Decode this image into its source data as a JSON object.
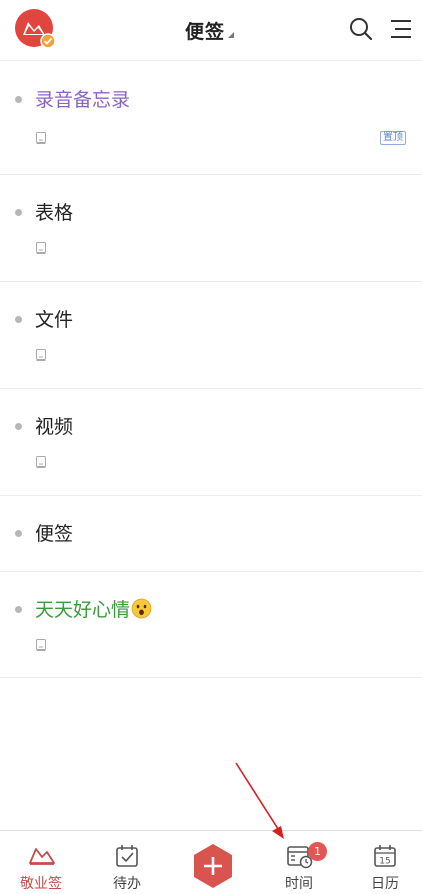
{
  "header": {
    "title": "便签"
  },
  "notes": [
    {
      "title": "录音备忘录",
      "color": "#8a63c6",
      "pinned_label": "置顶"
    },
    {
      "title": "表格",
      "color": "#222222"
    },
    {
      "title": "文件",
      "color": "#222222"
    },
    {
      "title": "视频",
      "color": "#222222"
    },
    {
      "title": "便签",
      "color": "#222222"
    },
    {
      "title": "天天好心情",
      "color": "#3b9b3b"
    }
  ],
  "tabbar": {
    "items": [
      {
        "label": "敬业签",
        "icon": "boat-icon",
        "active": true
      },
      {
        "label": "待办",
        "icon": "todo-check-icon"
      },
      {
        "label": "",
        "icon": "add-icon"
      },
      {
        "label": "时间",
        "icon": "time-calendar-icon",
        "badge": "1"
      },
      {
        "label": "日历",
        "icon": "calendar-15-icon",
        "day": "15"
      }
    ]
  },
  "colors": {
    "accent": "#d9534f",
    "active_tab": "#c84a4a",
    "dot": "#b7b7b7"
  }
}
